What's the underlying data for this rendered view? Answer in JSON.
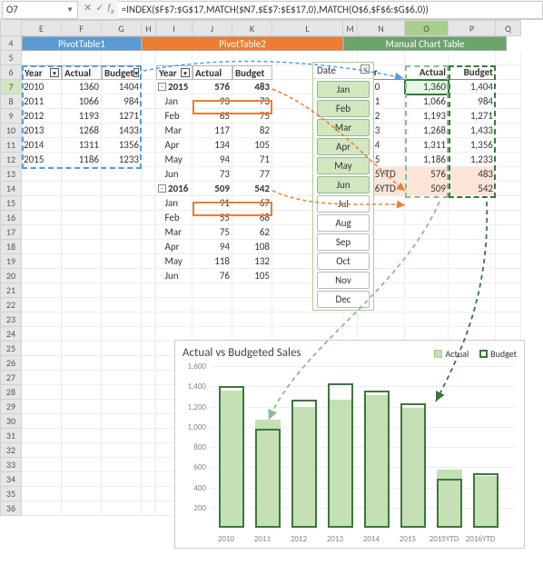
{
  "namebox": "O7",
  "formula": "=INDEX($F$7:$G$17,MATCH($N7,$E$7:$E$17,0),MATCH(O$6,$F$6:$G$6,0))",
  "cols": [
    "E",
    "F",
    "G",
    "H",
    "I",
    "J",
    "K",
    "L",
    "M",
    "N",
    "O",
    "P",
    "Q"
  ],
  "banners": {
    "p1": "PivotTable1",
    "p2": "PivotTable2",
    "p3": "Manual Chart Table"
  },
  "headers": {
    "year": "Year",
    "actual": "Actual",
    "budget": "Budget"
  },
  "pt1_rows": [
    {
      "y": "2010",
      "a": 1360,
      "b": 1404
    },
    {
      "y": "2011",
      "a": 1066,
      "b": 984
    },
    {
      "y": "2012",
      "a": 1193,
      "b": 1271
    },
    {
      "y": "2013",
      "a": 1268,
      "b": 1433
    },
    {
      "y": "2014",
      "a": 1311,
      "b": 1356
    },
    {
      "y": "2015",
      "a": 1186,
      "b": 1233
    }
  ],
  "pt2_rows": [
    {
      "y": "2015",
      "a": 576,
      "b": 483,
      "exp": "−"
    },
    {
      "y": "Jan",
      "a": 93,
      "b": 73
    },
    {
      "y": "Feb",
      "a": 65,
      "b": 75
    },
    {
      "y": "Mar",
      "a": 117,
      "b": 82
    },
    {
      "y": "Apr",
      "a": 134,
      "b": 105
    },
    {
      "y": "May",
      "a": 94,
      "b": 71
    },
    {
      "y": "Jun",
      "a": 73,
      "b": 77
    },
    {
      "y": "2016",
      "a": 509,
      "b": 542,
      "exp": "−"
    },
    {
      "y": "Jan",
      "a": 91,
      "b": 67
    },
    {
      "y": "Feb",
      "a": 55,
      "b": 68
    },
    {
      "y": "Mar",
      "a": 75,
      "b": 62
    },
    {
      "y": "Apr",
      "a": 94,
      "b": 108
    },
    {
      "y": "May",
      "a": 118,
      "b": 132
    },
    {
      "y": "Jun",
      "a": 76,
      "b": 105
    }
  ],
  "manual_rows": [
    {
      "y": "2010",
      "a": "1,360",
      "b": "1,404"
    },
    {
      "y": "2011",
      "a": "1,066",
      "b": "984"
    },
    {
      "y": "2012",
      "a": "1,193",
      "b": "1,271"
    },
    {
      "y": "2013",
      "a": "1,268",
      "b": "1,433"
    },
    {
      "y": "2014",
      "a": "1,311",
      "b": "1,356"
    },
    {
      "y": "2015",
      "a": "1,186",
      "b": "1,233"
    },
    {
      "y": "2015YTD",
      "a": "576",
      "b": "483",
      "peach": true
    },
    {
      "y": "2016YTD",
      "a": "509",
      "b": "542",
      "peach": true
    }
  ],
  "slicer": {
    "title": "Date",
    "items": [
      "Jan",
      "Feb",
      "Mar",
      "Apr",
      "May",
      "Jun",
      "Jul",
      "Aug",
      "Sep",
      "Oct",
      "Nov",
      "Dec"
    ],
    "selected": 6
  },
  "chart_data": {
    "type": "bar",
    "title": "Actual vs Budgeted Sales",
    "categories": [
      "2010",
      "2011",
      "2012",
      "2013",
      "2014",
      "2015",
      "2015YTD",
      "2016YTD"
    ],
    "series": [
      {
        "name": "Actual",
        "values": [
          1360,
          1066,
          1193,
          1268,
          1311,
          1186,
          576,
          509
        ]
      },
      {
        "name": "Budget",
        "values": [
          1404,
          984,
          1271,
          1433,
          1356,
          1233,
          483,
          542
        ]
      }
    ],
    "ylim": [
      0,
      1600
    ],
    "yticks": [
      200,
      400,
      600,
      800,
      1000,
      1200,
      1400,
      1600
    ],
    "ylabels": [
      "200",
      "400",
      "600",
      "800",
      "1,000",
      "1,200",
      "1,400",
      "1,600"
    ]
  }
}
